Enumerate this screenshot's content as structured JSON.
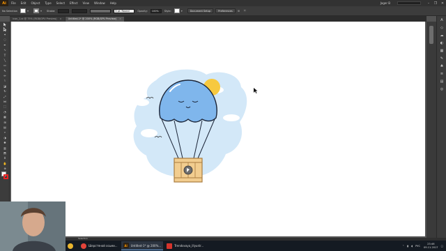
{
  "app": {
    "logo": "Ai"
  },
  "menu": {
    "items": [
      "File",
      "Edit",
      "Object",
      "Type",
      "Select",
      "Effect",
      "View",
      "Window",
      "Help"
    ]
  },
  "workspace": {
    "name": "Jager B"
  },
  "control": {
    "selection_label": "No Selection",
    "stroke_label": "Stroke:",
    "brush_name": "5 pt. Round",
    "opacity_label": "Opacity:",
    "opacity_value": "100%",
    "style_label": "Style:",
    "document_setup": "Document Setup",
    "preferences": "Preferences"
  },
  "tabs": [
    {
      "label": "icon_1.ai @ 75% (RGB/GPU Preview)"
    },
    {
      "label": "Untitled-1* @ 200% (RGB/GPU Preview)"
    }
  ],
  "status": {
    "tool": "Selection"
  },
  "taskbar": {
    "items": [
      {
        "label": "",
        "icon": "chrome-icon",
        "color": "#e9b52e"
      },
      {
        "label": "Шерстяной осьми...",
        "icon": "chrome-window-icon",
        "color": "#e3443a"
      },
      {
        "label": "Untitled-1* @ 200%...",
        "icon": "illustrator-icon",
        "color": "#ff9a00"
      },
      {
        "label": "Trendovaya_illyustr...",
        "icon": "pdf-icon",
        "color": "#d6342c"
      }
    ],
    "lang": "РУС",
    "time": "23:46",
    "date": "09.11.2017"
  },
  "colors": {
    "balloon": "#7fb6ec",
    "balloon_outline": "#1a2336",
    "cloud": "#cfe5f7",
    "sun": "#f7c93f",
    "crate": "#f2cd8f",
    "crate_dark": "#a87c3f"
  }
}
